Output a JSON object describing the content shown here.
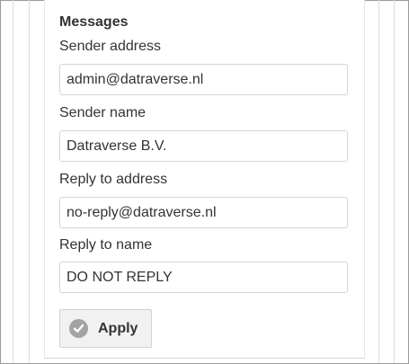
{
  "section": {
    "title": "Messages"
  },
  "fields": {
    "sender_address": {
      "label": "Sender address",
      "value": "admin@datraverse.nl"
    },
    "sender_name": {
      "label": "Sender name",
      "value": "Datraverse B.V."
    },
    "reply_to_address": {
      "label": "Reply to address",
      "value": "no-reply@datraverse.nl"
    },
    "reply_to_name": {
      "label": "Reply to name",
      "value": "DO NOT REPLY"
    }
  },
  "actions": {
    "apply_label": "Apply",
    "apply_icon": "check-circle-icon"
  }
}
